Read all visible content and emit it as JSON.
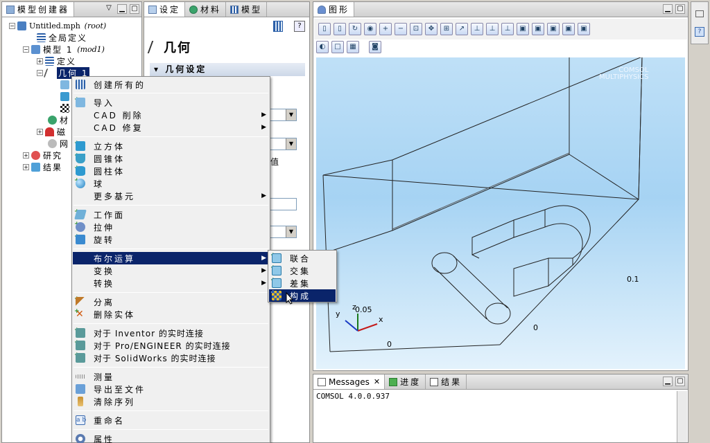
{
  "model_builder": {
    "tab_label": "模型创建器",
    "tree": [
      {
        "label": "Untitled.mph",
        "tag": "(root)"
      },
      {
        "label": "全局定义"
      },
      {
        "label": "模型 1",
        "tag": "(mod1)"
      },
      {
        "label": "定义"
      },
      {
        "label": "几何 1"
      },
      {
        "label": "材"
      },
      {
        "label": "磁"
      },
      {
        "label": "网"
      },
      {
        "label": "研究"
      },
      {
        "label": "结果"
      }
    ]
  },
  "settings": {
    "tabs": [
      "设定",
      "材料",
      "模型"
    ],
    "title": "几何",
    "section": "几何设定",
    "partial_text": "值"
  },
  "context_menu": {
    "items": [
      {
        "label": "创建所有的"
      },
      {
        "label": "导入"
      },
      {
        "label": "CAD 削除",
        "submenu": true
      },
      {
        "label": "CAD 修复",
        "submenu": true
      },
      {
        "label": "立方体"
      },
      {
        "label": "圆锥体"
      },
      {
        "label": "圆柱体"
      },
      {
        "label": "球"
      },
      {
        "label": "更多基元",
        "submenu": true
      },
      {
        "label": "工作面"
      },
      {
        "label": "拉伸"
      },
      {
        "label": "旋转"
      },
      {
        "label": "布尔运算",
        "submenu": true
      },
      {
        "label": "变换",
        "submenu": true
      },
      {
        "label": "转换",
        "submenu": true
      },
      {
        "label": "分离"
      },
      {
        "label": "删除实体"
      },
      {
        "label": "对于 Inventor 的实时连接"
      },
      {
        "label": "对于 Pro/ENGINEER 的实时连接"
      },
      {
        "label": "对于 SolidWorks 的实时连接"
      },
      {
        "label": "测量"
      },
      {
        "label": "导出至文件"
      },
      {
        "label": "清除序列"
      },
      {
        "label": "重命名"
      },
      {
        "label": "属性"
      }
    ]
  },
  "submenu": {
    "items": [
      "联合",
      "交集",
      "差集",
      "构成"
    ]
  },
  "graphics": {
    "tab_label": "图形",
    "watermark_line1": "COMSOL",
    "watermark_line2": "MULTIPHYSICS",
    "axis_labels": {
      "x": "x",
      "y": "y",
      "z": "z"
    },
    "tick_labels": [
      "0.05",
      "0",
      "0",
      "0.1"
    ]
  },
  "messages": {
    "tabs": [
      "Messages",
      "进度",
      "结果"
    ],
    "log": "COMSOL 4.0.0.937"
  }
}
